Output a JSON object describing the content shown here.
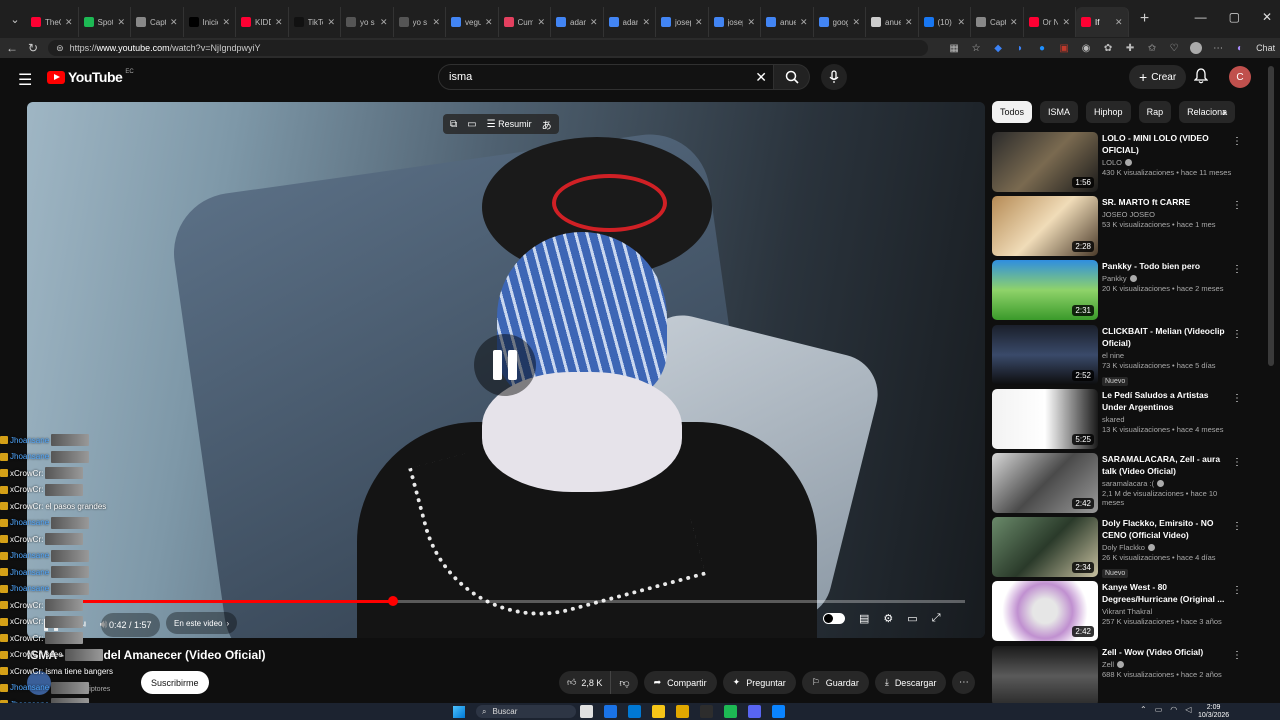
{
  "browser": {
    "tabs": [
      {
        "label": "TheG",
        "color": "#ff0033"
      },
      {
        "label": "Spoti",
        "color": "#1db954"
      },
      {
        "label": "Capt",
        "color": "#888888"
      },
      {
        "label": "Inicio",
        "color": "#000000"
      },
      {
        "label": "KIDD",
        "color": "#ff0033"
      },
      {
        "label": "TikTo",
        "color": "#111111"
      },
      {
        "label": "yo s",
        "color": "#555555"
      },
      {
        "label": "yo s",
        "color": "#555555"
      },
      {
        "label": "vegu",
        "color": "#4285f4"
      },
      {
        "label": "Cum",
        "color": "#e4405f"
      },
      {
        "label": "adam",
        "color": "#4285f4"
      },
      {
        "label": "adam",
        "color": "#4285f4"
      },
      {
        "label": "josep",
        "color": "#4285f4"
      },
      {
        "label": "josep",
        "color": "#4285f4"
      },
      {
        "label": "anue",
        "color": "#4285f4"
      },
      {
        "label": "goog",
        "color": "#4285f4"
      },
      {
        "label": "anue",
        "color": "#cccccc"
      },
      {
        "label": "(10) I",
        "color": "#1877f2"
      },
      {
        "label": "Capt",
        "color": "#888888"
      },
      {
        "label": "Or N",
        "color": "#ff0033"
      },
      {
        "label": "If",
        "color": "#ff0033"
      }
    ],
    "url_prefix": "https://",
    "url_host": "www.youtube.com",
    "url_path": "/watch?v=NjIgndpwyiY",
    "chat_label": "Chat"
  },
  "youtube": {
    "logo_text": "YouTube",
    "country_code": "EC",
    "search_value": "isma",
    "create_label": "Crear",
    "user_initial": "C"
  },
  "player": {
    "toolbar_label": "Resumir",
    "time_text": "0:42 / 1:57",
    "chapter_label": "En este video",
    "progress_fraction": 0.377
  },
  "video": {
    "title": "ISMA - Antes del Amanecer (Video Oficial)",
    "subscribers": "6,89 suscriptores",
    "subscribe_label": "Suscribirme",
    "likes": "2,8 K",
    "share_label": "Compartir",
    "ask_label": "Preguntar",
    "save_label": "Guardar",
    "download_label": "Descargar"
  },
  "chat": {
    "rows": [
      {
        "user": "Jhoansane",
        "msg": "",
        "alt": false,
        "emote": true
      },
      {
        "user": "Jhoansane",
        "msg": "",
        "alt": false,
        "emote": true
      },
      {
        "user": "xCrowCr:",
        "msg": "",
        "alt": true,
        "emote": true
      },
      {
        "user": "xCrowCr:",
        "msg": "",
        "alt": true,
        "emote": true
      },
      {
        "user": "xCrowCr:",
        "msg": "el pasos grandes",
        "alt": true,
        "emote": false
      },
      {
        "user": "Jhoansane",
        "msg": "",
        "alt": false,
        "emote": true
      },
      {
        "user": "xCrowCr:",
        "msg": "",
        "alt": true,
        "emote": true
      },
      {
        "user": "Jhoansane",
        "msg": "",
        "alt": false,
        "emote": true
      },
      {
        "user": "Jhoansane",
        "msg": "",
        "alt": false,
        "emote": true
      },
      {
        "user": "Jhoansane",
        "msg": "",
        "alt": false,
        "emote": true
      },
      {
        "user": "xCrowCr:",
        "msg": "",
        "alt": true,
        "emote": true
      },
      {
        "user": "xCrowCr:",
        "msg": "",
        "alt": true,
        "emote": true
      },
      {
        "user": "xCrowCr:",
        "msg": "",
        "alt": true,
        "emote": true
      },
      {
        "user": "xCrowCr:",
        "msg": "seee",
        "alt": true,
        "emote": true
      },
      {
        "user": "xCrowCr:",
        "msg": "isma tiene bangers",
        "alt": true,
        "emote": false
      },
      {
        "user": "Jhoansane",
        "msg": "",
        "alt": false,
        "emote": true
      },
      {
        "user": "Jhoansane",
        "msg": "",
        "alt": false,
        "emote": true
      }
    ]
  },
  "chips": [
    "Todos",
    "ISMA",
    "Hiphop",
    "Rap",
    "Relaciona"
  ],
  "recommendations": [
    {
      "title": "LOLO - MINI LOLO (VIDEO OFICIAL)",
      "channel": "LOLO",
      "verified": true,
      "views": "430 K visualizaciones • hace 11 meses",
      "duration": "1:56",
      "new": "",
      "thumb": "linear-gradient(135deg,#2b2b2b,#7a6a50,#1a1a1a)"
    },
    {
      "title": "SR. MARTO ft CARRE",
      "channel": "JOSEO JOSEO",
      "verified": false,
      "views": "53 K visualizaciones • hace 1 mes",
      "duration": "2:28",
      "new": "",
      "thumb": "linear-gradient(135deg,#b58a55,#f0dcb8,#4a3a2a)"
    },
    {
      "title": "Pankky - Todo bien pero",
      "channel": "Pankky",
      "verified": true,
      "views": "20 K visualizaciones • hace 2 meses",
      "duration": "2:31",
      "new": "",
      "thumb": "linear-gradient(180deg,#2f8ee0,#8fd36a,#3a9a2a)"
    },
    {
      "title": "CLICKBAIT - Melian (Videoclip Oficial)",
      "channel": "el nine",
      "verified": false,
      "views": "73 K visualizaciones • hace 5 días",
      "duration": "2:52",
      "new": "Nuevo",
      "thumb": "linear-gradient(180deg,#1a1f2a,#3a4a6a,#0d0d0d)"
    },
    {
      "title": "Le Pedí Saludos a Artistas Under Argentinos",
      "channel": "skared",
      "verified": false,
      "views": "13 K visualizaciones • hace 4 meses",
      "duration": "5:25",
      "new": "",
      "thumb": "linear-gradient(90deg,#f2f2f2,#ffffff,#1a1a1a)"
    },
    {
      "title": "SARAMALACARA, Zell - aura talk (Video Oficial)",
      "channel": "saramalacara :(",
      "verified": true,
      "views": "2,1 M de visualizaciones • hace 10 meses",
      "duration": "2:42",
      "new": "",
      "thumb": "linear-gradient(135deg,#d8d8d8,#4a4a4a,#9a9a9a)"
    },
    {
      "title": "Doly Flackko, Emirsito - NO CENO (Official Video)",
      "channel": "Doly Flackko",
      "verified": true,
      "views": "26 K visualizaciones • hace 4 días",
      "duration": "2:34",
      "new": "Nuevo",
      "thumb": "linear-gradient(135deg,#6a8a6a,#2a3a2a,#c8c0a0)"
    },
    {
      "title": "Kanye West - 80 Degrees/Hurricane (Original ...",
      "channel": "Vikrant Thakral",
      "verified": false,
      "views": "257 K visualizaciones • hace 3 años",
      "duration": "2:42",
      "new": "",
      "thumb": "radial-gradient(circle,#e6e6e6 20%,#c090d0 45%,#ffffff 70%)"
    },
    {
      "title": "Zell - Wow (Video Oficial)",
      "channel": "Zell",
      "verified": true,
      "views": "688 K visualizaciones • hace 2 años",
      "duration": "",
      "new": "",
      "thumb": "linear-gradient(180deg,#1a1a1a,#5a5a5a,#2a2a2a)"
    }
  ],
  "taskbar": {
    "search_label": "Buscar",
    "time": "2:09",
    "date": "10/3/2026",
    "apps": [
      "#e0e0e0",
      "#1a73e8",
      "#0078d4",
      "#f5c518",
      "#e0a800",
      "#2d2d2d",
      "#1db954",
      "#5865f2",
      "#0a84ff"
    ]
  }
}
